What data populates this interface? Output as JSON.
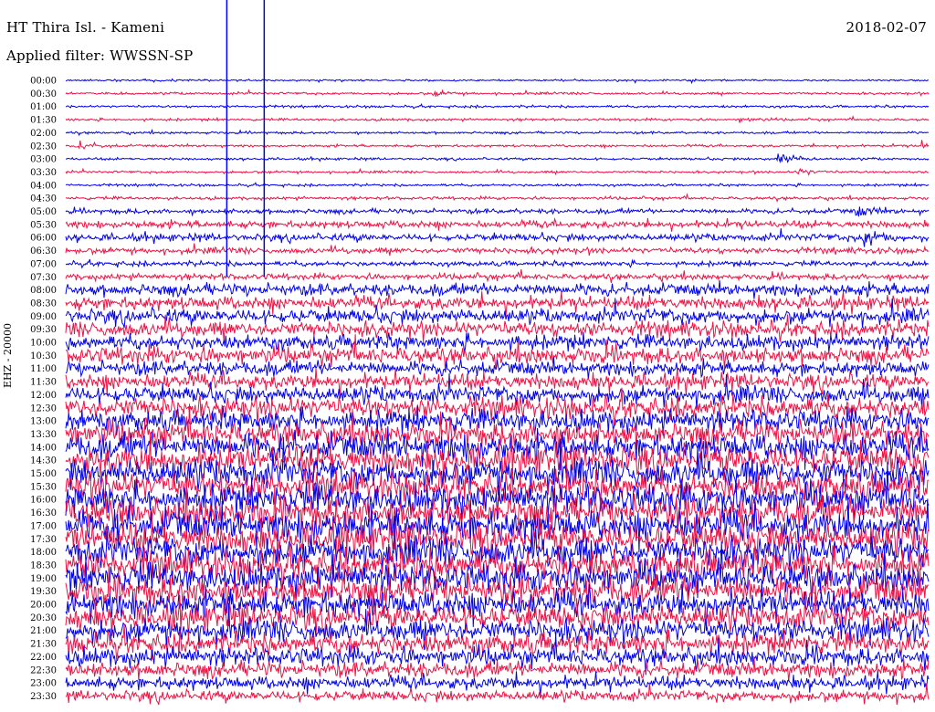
{
  "header": {
    "station": "HT Thira Isl. - Kameni",
    "filter": "Applied filter: WWSSN-SP",
    "date": "2018-02-07",
    "channel": "EHZ - 20000"
  },
  "chart_data": {
    "type": "line",
    "ylabel": "EHZ - 20000",
    "row_labels": [
      "00:00",
      "00:30",
      "01:00",
      "01:30",
      "02:00",
      "02:30",
      "03:00",
      "03:30",
      "04:00",
      "04:30",
      "05:00",
      "05:30",
      "06:00",
      "06:30",
      "07:00",
      "07:30",
      "08:00",
      "08:30",
      "09:00",
      "09:30",
      "10:00",
      "10:30",
      "11:00",
      "11:30",
      "12:00",
      "12:30",
      "13:00",
      "13:30",
      "14:00",
      "14:30",
      "15:00",
      "15:30",
      "16:00",
      "16:30",
      "17:00",
      "17:30",
      "18:00",
      "18:30",
      "19:00",
      "19:30",
      "20:00",
      "20:30",
      "21:00",
      "21:30",
      "22:00",
      "22:30",
      "23:00",
      "23:30"
    ],
    "colors": [
      "#0000ee",
      "#ee1144"
    ],
    "trace_window_minutes": 30,
    "noise_level": [
      1.5,
      2,
      2,
      2,
      2,
      2,
      2,
      2,
      2,
      2.5,
      4,
      6,
      6,
      5,
      4,
      5,
      10,
      11,
      12,
      13,
      12,
      14,
      12,
      13,
      14,
      18,
      18,
      20,
      22,
      24,
      24,
      24,
      25,
      25,
      26,
      26,
      25,
      25,
      24,
      24,
      22,
      21,
      19,
      17,
      15,
      13,
      11,
      9
    ],
    "events": [
      {
        "row": "02:30",
        "minute": 0.5,
        "amplitude": 8
      },
      {
        "row": "02:30",
        "minute": 29.8,
        "amplitude": 7
      },
      {
        "row": "03:00",
        "minute": 24.8,
        "amplitude": 14
      },
      {
        "row": "03:30",
        "minute": 25.5,
        "amplitude": 6
      },
      {
        "row": "01:30",
        "minute": 23.5,
        "amplitude": 4
      },
      {
        "row": "00:30",
        "minute": 12.8,
        "amplitude": 4
      },
      {
        "row": "05:00",
        "minute": 27.5,
        "amplitude": 10
      },
      {
        "row": "06:00",
        "minute": 27.8,
        "amplitude": 14
      }
    ],
    "spikes_minute": [
      5.6,
      6.9
    ],
    "xlim": [
      0,
      30
    ],
    "grid": false,
    "legend": "none"
  }
}
